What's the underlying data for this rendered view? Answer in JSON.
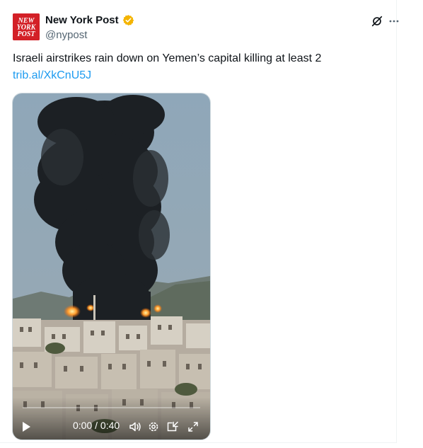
{
  "tweet": {
    "display_name": "New York Post",
    "handle": "@nypost",
    "text": "Israeli airstrikes rain down on Yemen’s capital killing at least 2",
    "link": "trib.al/XkCnU5J",
    "verified": true,
    "verified_badge_color": "#f4b400",
    "avatar": {
      "line1": "NEW",
      "line2": "YORK",
      "line3": "POST",
      "bg_color": "#d32027"
    },
    "icons": {
      "grok": "grok-slash-icon",
      "more": "more-dots-icon"
    }
  },
  "video": {
    "time_display": "0:00 / 0:40",
    "progress": 0,
    "link_color": "#1d9bf0",
    "controls": [
      "play-icon",
      "volume-icon",
      "settings-icon",
      "pop-out-icon",
      "fullscreen-icon"
    ]
  }
}
